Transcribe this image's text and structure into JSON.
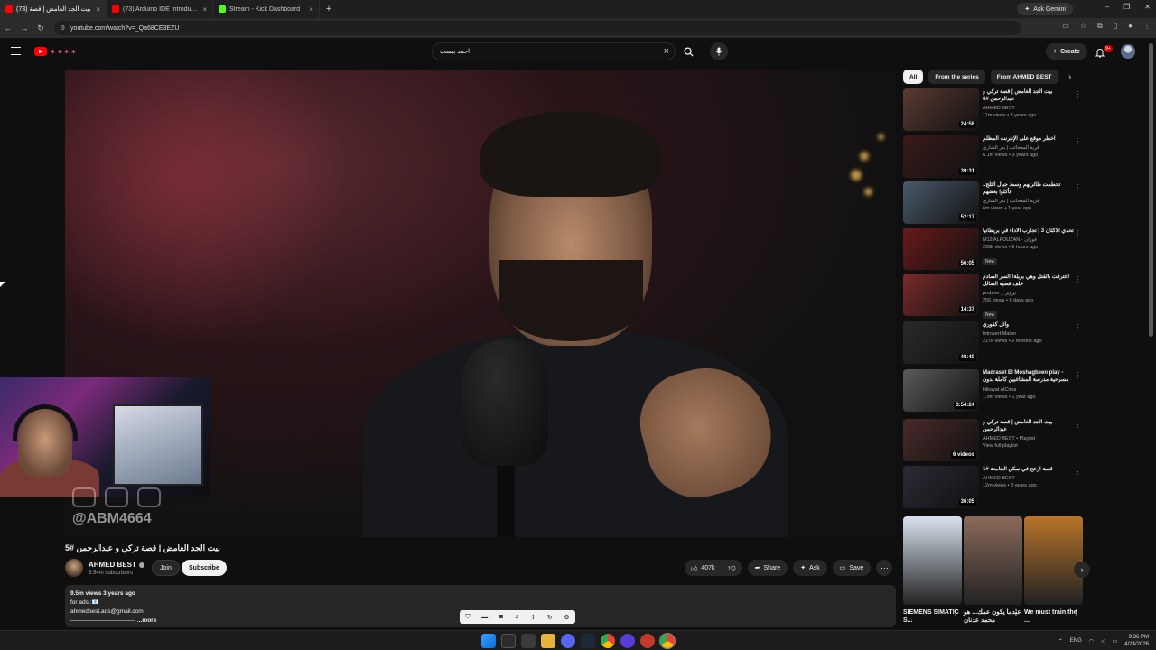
{
  "browser": {
    "tabs": [
      {
        "label": "بيت الجد الغامض | قصة (73)",
        "color": "#ff0000",
        "active": true
      },
      {
        "label": "(73) Arduino IDE Introduction -",
        "color": "#ff0000",
        "active": false
      },
      {
        "label": "Stream - Kick Dashboard",
        "color": "#53fc18",
        "active": false
      }
    ],
    "gemini_label": "Ask Gemini",
    "url": "youtube.com/watch?v=_Qa68CE3EZU"
  },
  "header": {
    "search_value": "احمد بيست",
    "create_label": "Create",
    "notif_count": "9+"
  },
  "video": {
    "overlay_handle": "@ABM4664",
    "title": "بيت الجد الغامض | قصة تركي و عبدالرحمن #5",
    "channel_name": "AHMED BEST",
    "subscribers": "5.54m subscribers",
    "join_label": "Join",
    "subscribe_label": "Subscribe",
    "likes": "407k",
    "share_label": "Share",
    "ask_label": "Ask",
    "save_label": "Save"
  },
  "description": {
    "stats": "9.5m views  3 years ago",
    "line1": "for ads :📧",
    "line2": "ahmedbest.ads@gmail.com",
    "line3": "———————————",
    "more_label": "...more"
  },
  "sidebar": {
    "chips": [
      "All",
      "From the series",
      "From AHMED BEST"
    ],
    "recommendations": [
      {
        "title": "بيت الجد الغامض | قصة تركي و عبدالرحمن #6",
        "channel": "AHMED BEST",
        "meta": "11m views • 3 years ago",
        "duration": "24:58",
        "badge": "",
        "thumb": "#5a3a32"
      },
      {
        "title": "اخطر موقع على الإنترنت المظلم",
        "channel": "قرية المعجائب | بدر الشاري",
        "meta": "6.1m views • 3 years ago",
        "duration": "39:31",
        "badge": "",
        "thumb": "#3a1a1a"
      },
      {
        "title": "تحطمت طائرتهم وسط جبال الثلج.. فأكلوا بعضهم",
        "channel": "قرية المعجائب | بدر الشاري",
        "meta": "6m views • 1 year ago",
        "duration": "52:17",
        "badge": "",
        "thumb": "#4a5a6a"
      },
      {
        "title": "تحدي الاكثان 3 | تجارب الأداء في بريطانيا",
        "channel": "M12 ALFOUZAN - فوزان",
        "meta": "296k views • 9 hours ago",
        "duration": "56:05",
        "badge": "New",
        "thumb": "#6a1a1a"
      },
      {
        "title": "اعترفت بالقتل وهي بريئة! السر الصادم خلف قضية الضالل",
        "channel": "probeer _ بروبر",
        "meta": "256 views • 6 days ago",
        "duration": "14:37",
        "badge": "New",
        "thumb": "#7a2a2a"
      },
      {
        "title": "وائل كفوري",
        "channel": "Introvert Matter",
        "meta": "227k views • 2 months ago",
        "duration": "48:40",
        "badge": "",
        "thumb": "#2a2a2a"
      },
      {
        "title": "Madraset El Moshagbeen play - مسرحية مدرسة المشاغبين كاملة بدون حذف",
        "channel": "Hikayat AlCima",
        "meta": "1.9m views • 1 year ago",
        "duration": "3:54:24",
        "badge": "",
        "thumb": "#5a5a5a"
      },
      {
        "title": "بيت الجد الغامض | قصة تركي و عبدالرحمن",
        "channel": "AHMED BEST • Playlist",
        "meta": "View full playlist",
        "duration": "6 videos",
        "badge": "",
        "thumb": "#4a2a2a"
      },
      {
        "title": "قصة ازعج في سكن الجامعة #1",
        "channel": "AHMED BEST",
        "meta": "12m views • 3 years ago",
        "duration": "36:05",
        "badge": "",
        "thumb": "#2a2a35"
      }
    ],
    "shorts": [
      {
        "title": "SIEMENS SIMATIC S...",
        "thumb": "#d8e2ee"
      },
      {
        "title": "عندما يكون عمك... هو محمد عدنان",
        "thumb": "#8a6a5a"
      },
      {
        "title": "We must train the ...",
        "thumb": "#b8742a"
      }
    ]
  },
  "taskbar": {
    "lang": "ENG",
    "time": "9:36 PM",
    "date": "4/24/2026"
  }
}
